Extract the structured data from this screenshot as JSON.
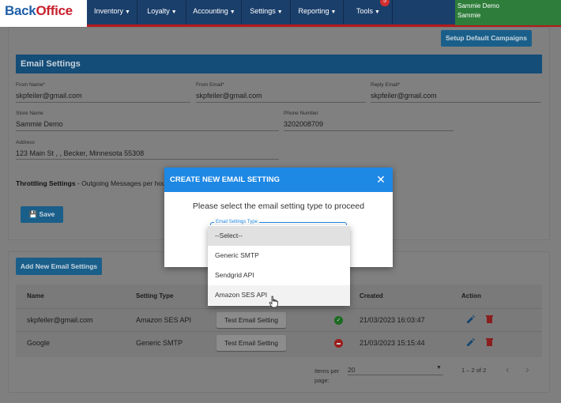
{
  "brand": {
    "part1": "Back",
    "part2": "Office"
  },
  "nav": {
    "items": [
      "Inventory",
      "Loyalty",
      "Accounting",
      "Settings",
      "Reporting",
      "Tools"
    ],
    "tools_badge": "5",
    "user": {
      "store": "Sammie Demo",
      "name": "Sammie"
    }
  },
  "page": {
    "setup_button": "Setup Default Campaigns",
    "section_title": "Email Settings",
    "fields": {
      "from_name": {
        "label": "From Name*",
        "value": "skpfeiler@gmail.com"
      },
      "from_email": {
        "label": "From Email*",
        "value": "skpfeiler@gmail.com"
      },
      "reply_email": {
        "label": "Reply Email*",
        "value": "skpfeiler@gmail.com"
      },
      "store_name": {
        "label": "Store Name",
        "value": "Sammie Demo"
      },
      "phone": {
        "label": "Phone Number",
        "value": "3202008709"
      },
      "address": {
        "label": "Address",
        "value": "123 Main St , , Becker, Minnesota 55308"
      }
    },
    "throttling": {
      "title": "Throttling Settings",
      "rest": " - Outgoing Messages per hour"
    },
    "save_button": "Save",
    "add_button": "Add New Email Settings",
    "table": {
      "headers": {
        "name": "Name",
        "type": "Setting Type",
        "created": "Created",
        "action": "Action"
      },
      "rows": [
        {
          "name": "skpfeiler@gmail.com",
          "type": "Amazon SES API",
          "test": "Test Email Setting",
          "status": "ok",
          "created": "21/03/2023 16:03:47"
        },
        {
          "name": "Google",
          "type": "Generic SMTP",
          "test": "Test Email Setting",
          "status": "error",
          "created": "21/03/2023 15:15:44"
        }
      ]
    },
    "pager": {
      "items_label_1": "Items per",
      "items_label_2": "page:",
      "page_size": "20",
      "range": "1 – 2 of 2"
    }
  },
  "modal": {
    "title": "CREATE NEW EMAIL SETTING",
    "message": "Please select the email setting type to proceed",
    "select_label": "Email Settings Type",
    "options": [
      "--Select--",
      "Generic SMTP",
      "Sendgrid API",
      "Amazon SES API"
    ]
  },
  "colors": {
    "primary": "#1e88e5",
    "nav": "#1b3f6b",
    "brand_red": "#c8202c",
    "ok": "#2e7d32",
    "error": "#c62828"
  }
}
